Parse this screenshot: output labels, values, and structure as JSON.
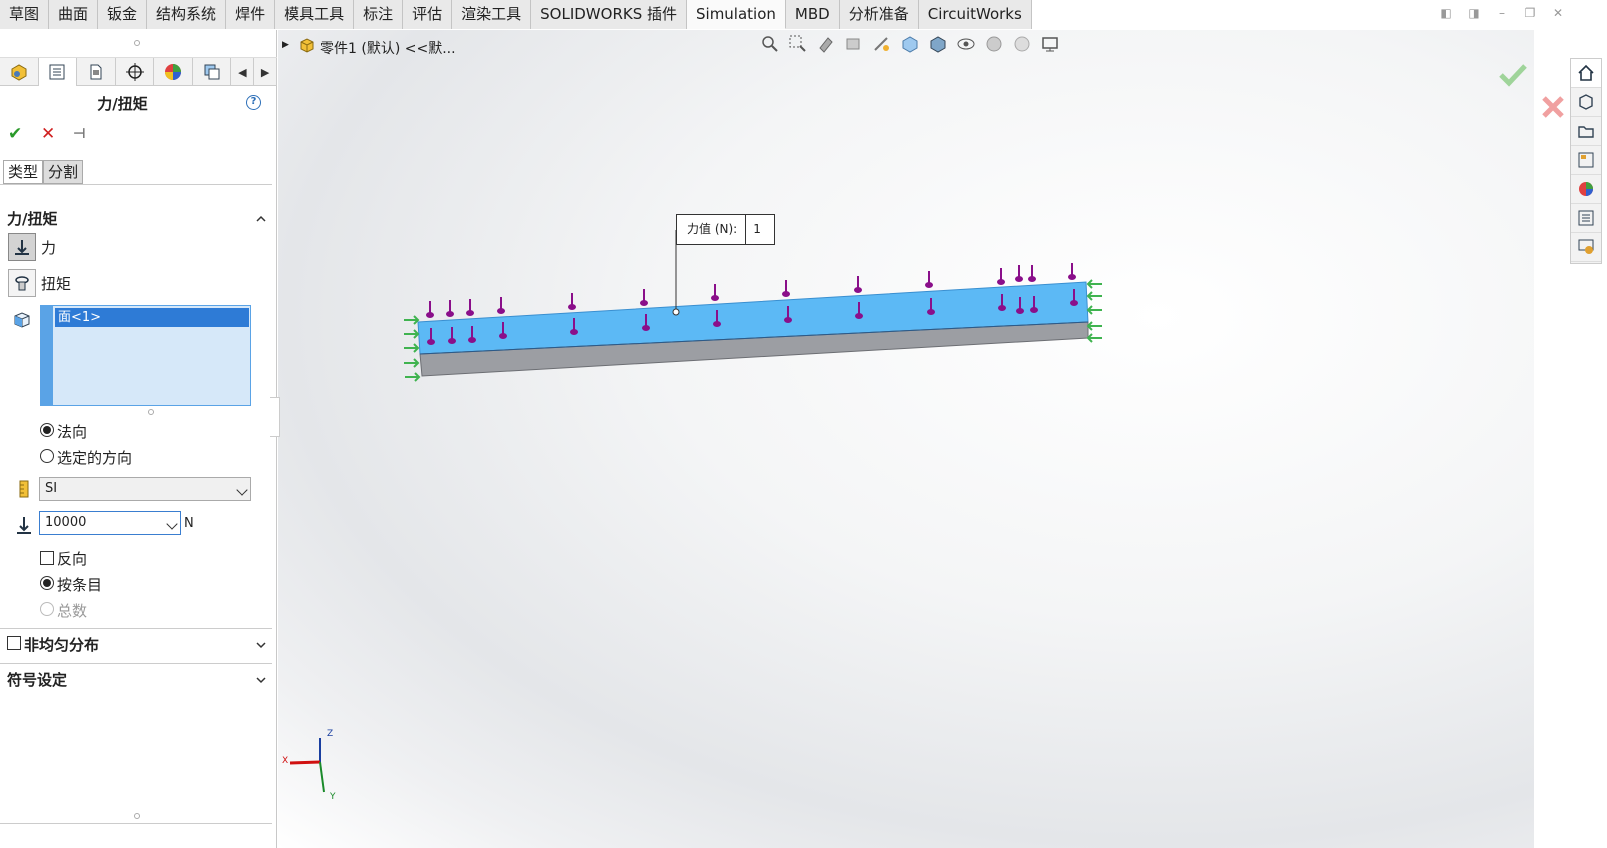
{
  "tabs": [
    "草图",
    "曲面",
    "钣金",
    "结构系统",
    "焊件",
    "模具工具",
    "标注",
    "评估",
    "渲染工具",
    "SOLIDWORKS 插件",
    "Simulation",
    "MBD",
    "分析准备",
    "CircuitWorks"
  ],
  "active_tab": "Simulation",
  "property_manager": {
    "title": "力/扭矩",
    "subtabs": [
      "类型",
      "分割"
    ],
    "section_force_torque": "力/扭矩",
    "force_label": "力",
    "torque_label": "扭矩",
    "selection_item": "面<1>",
    "radio_normal": "法向",
    "radio_selected_direction": "选定的方向",
    "units_value": "SI",
    "force_value": "10000",
    "force_unit": "N",
    "reverse_label": "反向",
    "per_item_label": "按条目",
    "total_label": "总数",
    "nonuniform_label": "非均匀分布",
    "symbol_settings_label": "符号设定"
  },
  "breadcrumb": "零件1 (默认) <<默...",
  "callout": {
    "label": "力值 (N):",
    "value": "1"
  },
  "triad": {
    "x": "X",
    "y": "Y",
    "z": "Z"
  },
  "colors": {
    "face": "#5cb9f5",
    "side": "#9c9ea3",
    "force_arrow": "#8a0f8a",
    "fixture": "#3fb34f",
    "accent": "#2e7bd6"
  },
  "icons": {
    "confirm": "check-icon",
    "cancel": "close-icon",
    "pin": "pin-icon"
  }
}
